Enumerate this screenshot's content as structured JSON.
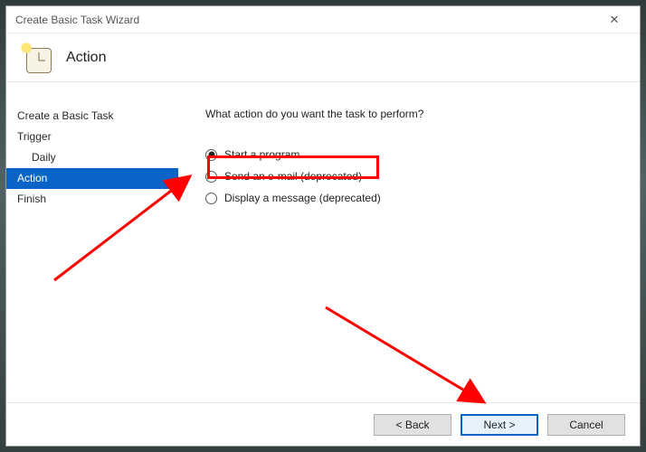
{
  "window": {
    "title": "Create Basic Task Wizard",
    "close_label": "✕"
  },
  "header": {
    "title": "Action",
    "icon": "task-scheduler-icon"
  },
  "sidebar": {
    "items": [
      {
        "label": "Create a Basic Task",
        "indent": false,
        "selected": false
      },
      {
        "label": "Trigger",
        "indent": false,
        "selected": false
      },
      {
        "label": "Daily",
        "indent": true,
        "selected": false
      },
      {
        "label": "Action",
        "indent": false,
        "selected": true
      },
      {
        "label": "Finish",
        "indent": false,
        "selected": false
      }
    ]
  },
  "content": {
    "prompt": "What action do you want the task to perform?",
    "options": [
      {
        "label": "Start a program",
        "checked": true
      },
      {
        "label": "Send an e-mail (deprecated)",
        "checked": false
      },
      {
        "label": "Display a message (deprecated)",
        "checked": false
      }
    ]
  },
  "footer": {
    "back": "< Back",
    "next": "Next >",
    "cancel": "Cancel"
  },
  "annotations": {
    "highlight_option_index": 0,
    "arrow_to_option": true,
    "arrow_to_next": true
  }
}
